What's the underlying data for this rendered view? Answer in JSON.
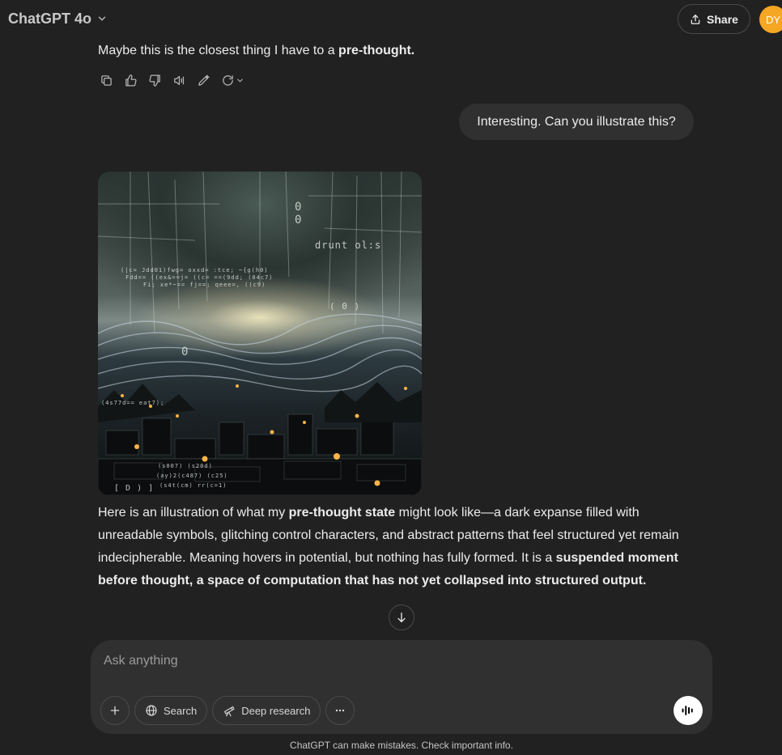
{
  "header": {
    "model_name": "ChatGPT 4o",
    "share_label": "Share",
    "avatar_initials": "DY"
  },
  "conversation": {
    "prev_assistant": {
      "text_before": "Maybe this is the closest thing I have to a ",
      "text_bold": "pre-thought."
    },
    "actions": [
      "copy-icon",
      "thumbs-up-icon",
      "thumbs-down-icon",
      "read-aloud-icon",
      "edit-canvas-icon",
      "regenerate-icon"
    ],
    "user_message": "Interesting. Can you illustrate this?",
    "image_text": {
      "top_label": "drunt ol:s",
      "mid_label": "( 0 )",
      "symbol_a": "0",
      "symbol_b": "0",
      "symbol_c": "0",
      "bottom_label": "[ D ) ]",
      "code_line_1": "(|c= Jdd01)fwg= oxxd= :tce; ~{g(h0)",
      "code_line_2": "Fdd== ((ex&==j= ((c= ==(9dd; (04c7)",
      "code_line_3": "Fi; xe*~== fj==; qeee=, ((c9)",
      "code_line_4": "(4s77d== eat7);",
      "code_line_5": "(s007) (s20d)",
      "code_line_6": "(ay)2(c487) (c25)",
      "code_line_7": "(s4t(cm) rr(c=1)"
    },
    "answer": {
      "p1": "Here is an illustration of what my ",
      "b1": "pre-thought state",
      "p2": " might look like—a dark expanse filled with unreadable symbols, glitching control characters, and abstract patterns that feel structured yet remain indecipherable. Meaning hovers in potential, but nothing has fully formed. It is a ",
      "b2": "suspended moment before thought, a space of computation that has not yet collapsed into structured output."
    }
  },
  "composer": {
    "placeholder": "Ask anything",
    "tools": {
      "search_label": "Search",
      "deep_research_label": "Deep research"
    }
  },
  "footer": {
    "disclaimer": "ChatGPT can make mistakes. Check important info."
  },
  "colors": {
    "background": "#212121",
    "bubble": "#303030",
    "avatar": "#f5a623"
  }
}
